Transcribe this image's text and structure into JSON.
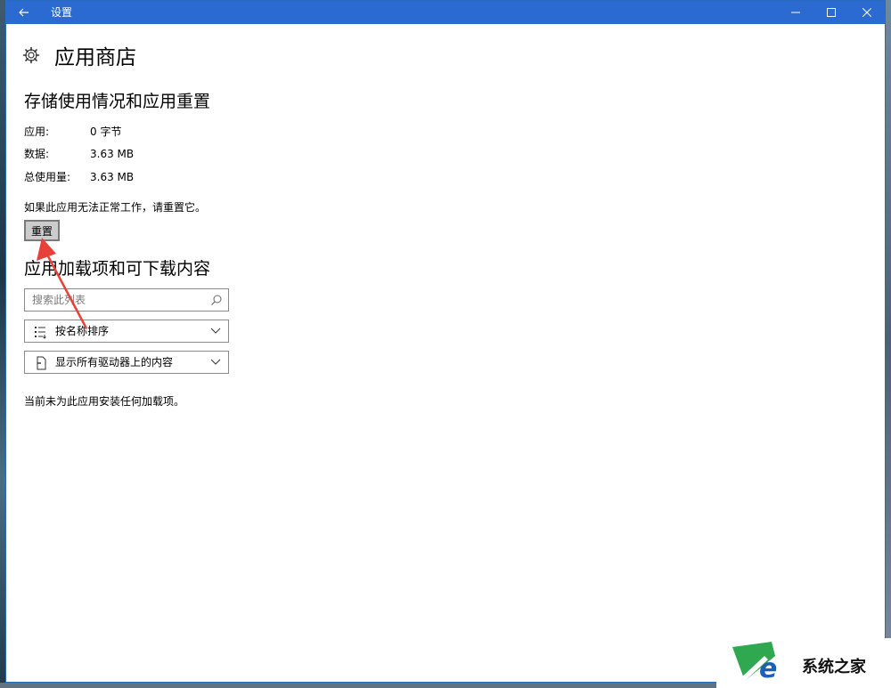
{
  "window": {
    "title": "设置"
  },
  "page": {
    "title": "应用商店"
  },
  "storage": {
    "heading": "存储使用情况和应用重置",
    "rows": [
      {
        "label": "应用:",
        "value": "0 字节"
      },
      {
        "label": "数据:",
        "value": "3.63 MB"
      },
      {
        "label": "总使用量:",
        "value": "3.63 MB"
      }
    ],
    "reset_note": "如果此应用无法正常工作，请重置它。",
    "reset_label": "重置"
  },
  "addons": {
    "heading": "应用加载项和可下载内容",
    "search_placeholder": "搜索此列表",
    "sort_label": "按名称排序",
    "filter_label": "显示所有驱动器上的内容",
    "empty_note": "当前未为此应用安装任何加载项。"
  },
  "watermark": {
    "text": "系统之家"
  },
  "colors": {
    "titlebar": "#2b6bd1",
    "arrow": "#e8413a"
  },
  "icons": [
    "back-arrow-icon",
    "minimize-icon",
    "maximize-icon",
    "close-icon",
    "gear-icon",
    "search-icon",
    "sort-list-icon",
    "drive-icon",
    "chevron-down-icon"
  ]
}
